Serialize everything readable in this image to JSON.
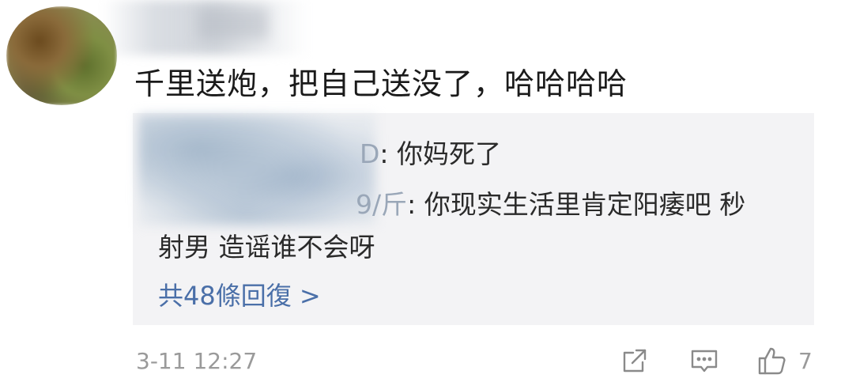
{
  "comment": {
    "text": "千里送炮，把自己送没了，哈哈哈哈"
  },
  "replies": [
    {
      "name_tail": "D",
      "text": ": 你妈死了"
    },
    {
      "name_tail": "9/斤",
      "text": ": 你现实生活里肯定阳痿吧 秒",
      "continuation": "射男 造谣谁不会呀"
    }
  ],
  "more_replies_label": "共48條回復 >",
  "meta": {
    "timestamp": "3-11 12:27",
    "like_count": "7"
  },
  "icons": {
    "share": "share-icon",
    "reply": "comment-icon",
    "like": "thumbs-up-icon"
  },
  "colors": {
    "link": "#4a6fa8",
    "meta": "#9a9a9a",
    "reply_bg": "#f3f3f5"
  }
}
